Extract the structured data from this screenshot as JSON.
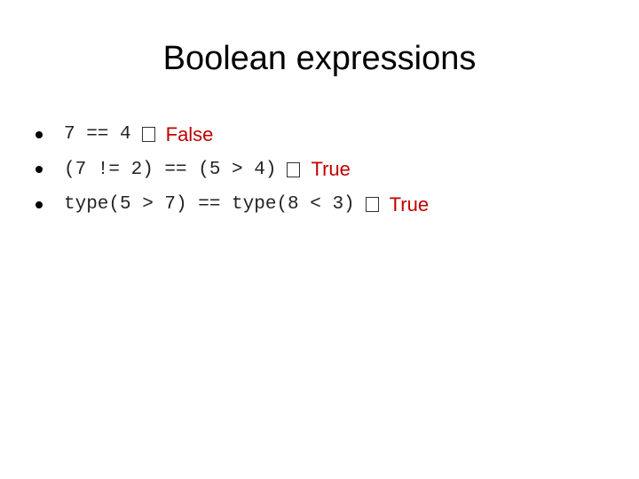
{
  "slide": {
    "title": "Boolean expressions",
    "bullets": [
      {
        "expression": "7 == 4",
        "arrow_icon": "missing-glyph-box",
        "result": "False"
      },
      {
        "expression": "(7 != 2) == (5 > 4)",
        "arrow_icon": "missing-glyph-box",
        "result": "True"
      },
      {
        "expression": "type(5 > 7) == type(8 < 3)",
        "arrow_icon": "missing-glyph-box",
        "result": "True"
      }
    ],
    "result_color": "#c00000"
  }
}
